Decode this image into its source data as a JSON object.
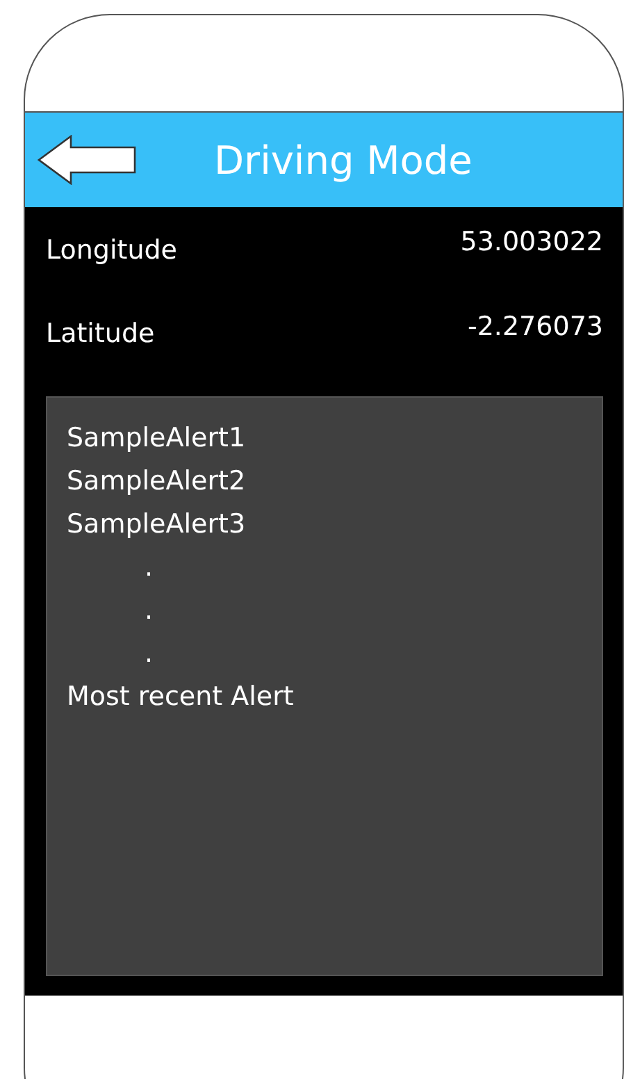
{
  "header": {
    "title": "Driving Mode"
  },
  "readings": [
    {
      "label": "Longitude",
      "value": "53.003022"
    },
    {
      "label": "Latitude",
      "value": "-2.276073"
    }
  ],
  "alerts": [
    {
      "kind": "alert",
      "text": "SampleAlert1"
    },
    {
      "kind": "alert",
      "text": "SampleAlert2"
    },
    {
      "kind": "alert",
      "text": "SampleAlert3"
    },
    {
      "kind": "dot",
      "text": "."
    },
    {
      "kind": "dot",
      "text": "."
    },
    {
      "kind": "dot",
      "text": "."
    },
    {
      "kind": "alert",
      "text": "Most recent Alert"
    }
  ]
}
